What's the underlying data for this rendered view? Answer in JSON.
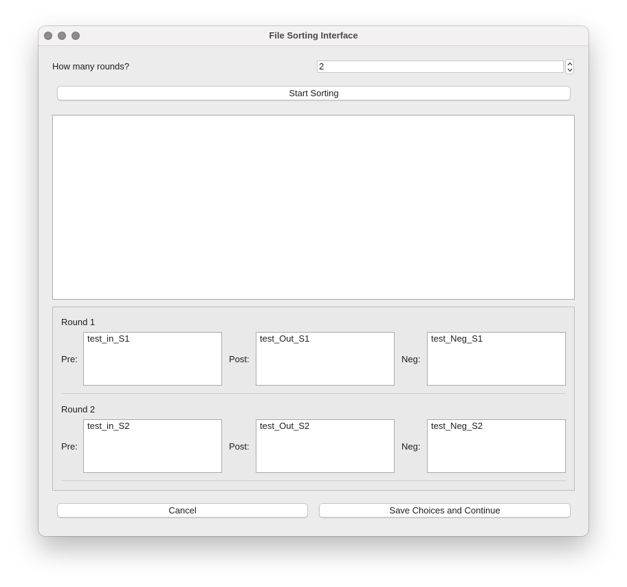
{
  "window": {
    "title": "File Sorting Interface"
  },
  "rounds_setting": {
    "label": "How many rounds?",
    "value": "2"
  },
  "start_button": {
    "label": "Start Sorting"
  },
  "log": {
    "content": ""
  },
  "rounds": [
    {
      "title": "Round 1",
      "pre_label": "Pre:",
      "pre_value": "test_in_S1",
      "post_label": "Post:",
      "post_value": "test_Out_S1",
      "neg_label": "Neg:",
      "neg_value": "test_Neg_S1"
    },
    {
      "title": "Round 2",
      "pre_label": "Pre:",
      "pre_value": "test_in_S2",
      "post_label": "Post:",
      "post_value": "test_Out_S2",
      "neg_label": "Neg:",
      "neg_value": "test_Neg_S2"
    }
  ],
  "footer": {
    "cancel_label": "Cancel",
    "save_label": "Save Choices and Continue"
  },
  "icons": {
    "close": "close-dot-icon",
    "minimize": "minimize-dot-icon",
    "zoom": "zoom-dot-icon",
    "spinner": "stepper-arrows-icon"
  },
  "colors": {
    "window_bg": "#ececec",
    "titlebar_bg": "#f3f1f2",
    "traffic_inactive": "#8e8c8d",
    "field_bg": "#ffffff"
  }
}
